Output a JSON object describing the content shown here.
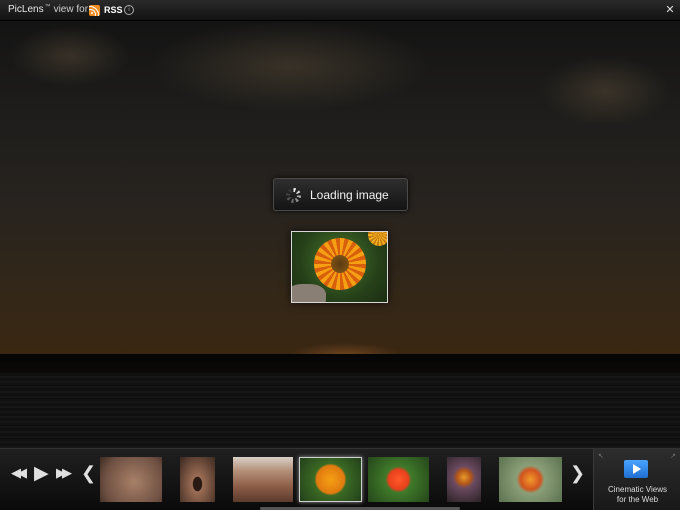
{
  "app": {
    "name": "PicLens",
    "trademark": "™",
    "view_for": "view for",
    "feed_name": "RSS"
  },
  "icons": {
    "rss": "rss-feed-icon",
    "info": "info-icon",
    "close": "close-icon",
    "spinner": "loading-spinner-icon",
    "rewind": "rewind-icon",
    "play": "play-icon",
    "fast_forward": "fast-forward-icon",
    "prev": "chevron-left-icon",
    "next": "chevron-right-icon",
    "promo": "play-screen-icon"
  },
  "glyphs": {
    "info": "i",
    "close": "✕",
    "rewind": "◀◀",
    "play": "▶",
    "fast_forward": "▶▶",
    "prev": "❮",
    "next": "❯"
  },
  "status": {
    "loading_text": "Loading image"
  },
  "promo": {
    "line1": "Cinematic Views",
    "line2": "for the Web"
  },
  "colors": {
    "rss_orange": "#f18a1f",
    "promo_blue": "#2f86e6",
    "selected_border": "#cfcfcf"
  }
}
